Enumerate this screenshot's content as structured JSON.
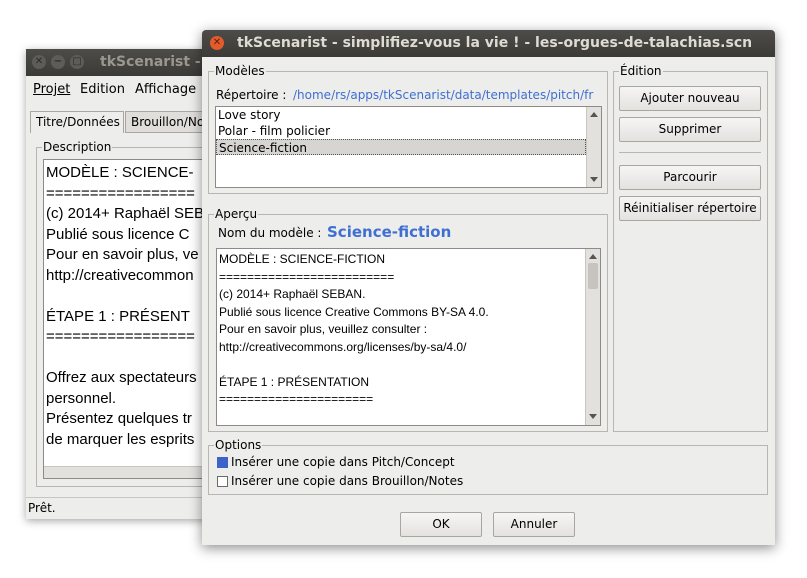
{
  "back_window": {
    "title": "tkScenarist - s",
    "menu": [
      "Projet",
      "Edition",
      "Affichage"
    ],
    "tabs": [
      "Titre/Données",
      "Brouillon/No"
    ],
    "description_label": "Description",
    "text_lines": [
      "MODÈLE : SCIENCE-",
      "=================",
      "(c) 2014+ Raphaël SEB",
      "Publié sous licence C",
      "Pour en savoir plus, ve",
      "http://creativecommon",
      "",
      "ÉTAPE 1 : PRÉSENT",
      "=================",
      "",
      "Offrez aux spectateurs",
      "personnel.",
      "Présentez quelques tr",
      "de marquer les esprits"
    ],
    "status": "Prêt."
  },
  "dialog": {
    "title": "tkScenarist - simplifiez-vous la vie ! - les-orgues-de-talachias.scn",
    "models_label": "Modèles",
    "dir_label": "Répertoire :",
    "dir_path": "/home/rs/apps/tkScenarist/data/templates/pitch/fr",
    "models": [
      "Love story",
      "Polar - film policier",
      "Science-fiction"
    ],
    "selected_model": 2,
    "preview_label": "Aperçu",
    "model_name_label": "Nom du modèle :",
    "model_name": "Science-fiction",
    "preview_lines": [
      "MODÈLE : SCIENCE-FICTION",
      "=========================",
      "(c) 2014+ Raphaël SEBAN.",
      "Publié sous licence Creative Commons BY-SA 4.0.",
      "Pour en savoir plus, veuillez consulter :",
      "http://creativecommons.org/licenses/by-sa/4.0/",
      "",
      "ÉTAPE 1 : PRÉSENTATION",
      "======================"
    ],
    "edition_label": "Édition",
    "btn_add": "Ajouter nouveau",
    "btn_delete": "Supprimer",
    "btn_browse": "Parcourir",
    "btn_reset": "Réinitialiser répertoire",
    "options_label": "Options",
    "opt1": "Insérer une copie dans Pitch/Concept",
    "opt1_checked": true,
    "opt2": "Insérer une copie dans Brouillon/Notes",
    "opt2_checked": false,
    "ok": "OK",
    "cancel": "Annuler"
  },
  "colors": {
    "accent": "#3c64c8",
    "link": "#3f6fd2",
    "titlebar": "#3d3c38",
    "close": "#e25b2b"
  }
}
